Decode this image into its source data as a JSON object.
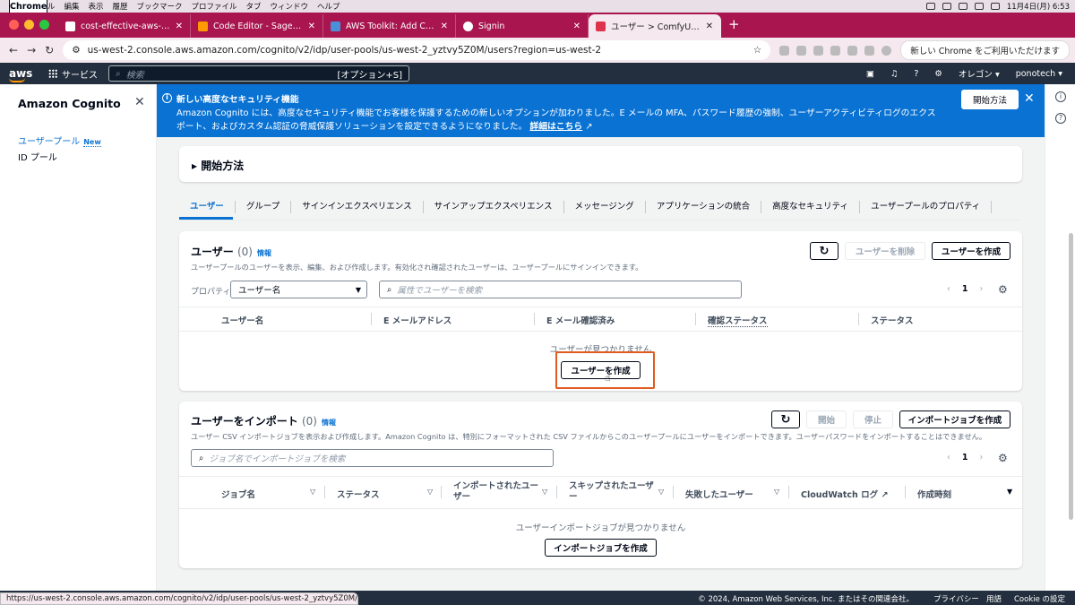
{
  "mac": {
    "menu": [
      "Chrome",
      "ファイル",
      "編集",
      "表示",
      "履歴",
      "ブックマーク",
      "プロファイル",
      "タブ",
      "ウィンドウ",
      "ヘルプ"
    ],
    "clock": "11月4日(月) 6:53"
  },
  "tabs": [
    {
      "title": "cost-effective-aws-deployme"
    },
    {
      "title": "Code Editor - SageMaker Stu"
    },
    {
      "title": "AWS Toolkit: Add Connection"
    },
    {
      "title": "Signin"
    },
    {
      "title": "ユーザー > ComfyUIuserPoolS"
    }
  ],
  "address": {
    "url": "us-west-2.console.aws.amazon.com/cognito/v2/idp/user-pools/us-west-2_yztvy5Z0M/users?region=us-west-2",
    "chrome_notice": "新しい Chrome をご利用いただけます"
  },
  "aws_nav": {
    "logo": "aws",
    "services": "サービス",
    "search_placeholder": "検索",
    "search_shortcut": "[オプション+S]",
    "region": "オレゴン ▾",
    "account": "ponotech ▾"
  },
  "sidebar": {
    "title": "Amazon Cognito",
    "items": [
      {
        "label": "ユーザープール",
        "badge": "New"
      },
      {
        "label": "ID プール"
      }
    ]
  },
  "banner": {
    "title": "新しい高度なセキュリティ機能",
    "text": "Amazon Cognito には、高度なセキュリティ機能でお客様を保護するための新しいオプションが加わりました。E メールの MFA、パスワード履歴の強制、ユーザーアクティビティログのエクスポート、およびカスタム認証の脅威保護ソリューションを設定できるようになりました。",
    "link": "詳細はこちら",
    "button": "開始方法"
  },
  "getting_started": {
    "label": "開始方法"
  },
  "page_tabs": [
    "ユーザー",
    "グループ",
    "サインインエクスペリエンス",
    "サインアップエクスペリエンス",
    "メッセージング",
    "アプリケーションの統合",
    "高度なセキュリティ",
    "ユーザープールのプロパティ"
  ],
  "users": {
    "title": "ユーザー",
    "count": "(0)",
    "info": "情報",
    "description": "ユーザープールのユーザーを表示、編集、および作成します。有効化され確認されたユーザーは、ユーザープールにサインインできます。",
    "delete_button": "ユーザーを削除",
    "create_button": "ユーザーを作成",
    "property_label": "プロパティ:",
    "property_value": "ユーザー名",
    "search_placeholder": "属性でユーザーを検索",
    "page": "1",
    "columns": [
      "ユーザー名",
      "E メールアドレス",
      "E メール確認済み",
      "確認ステータス",
      "ステータス"
    ],
    "empty_text": "ユーザーが見つかりません",
    "empty_create_button": "ユーザーを作成"
  },
  "imports": {
    "title": "ユーザーをインポート",
    "count": "(0)",
    "info": "情報",
    "description": "ユーザー CSV インポートジョブを表示および作成します。Amazon Cognito は、特別にフォーマットされた CSV ファイルからこのユーザープールにユーザーをインポートできます。ユーザーパスワードをインポートすることはできません。",
    "start_button": "開始",
    "stop_button": "停止",
    "create_button": "インポートジョブを作成",
    "search_placeholder": "ジョブ名でインポートジョブを検索",
    "page": "1",
    "columns": [
      "ジョブ名",
      "ステータス",
      "インポートされたユーザー",
      "スキップされたユーザー",
      "失敗したユーザー",
      "CloudWatch ログ",
      "作成時刻"
    ],
    "empty_text": "ユーザーインポートジョブが見つかりません",
    "empty_create_button": "インポートジョブを作成"
  },
  "footer": {
    "copyright": "© 2024, Amazon Web Services, Inc. またはその関連会社。",
    "privacy": "プライバシー",
    "terms": "用語",
    "cookie": "Cookie の設定"
  },
  "status_url": "https://us-west-2.console.aws.amazon.com/cognito/v2/idp/user-pools/us-west-2_yztvy5Z0M/users/create/u..."
}
